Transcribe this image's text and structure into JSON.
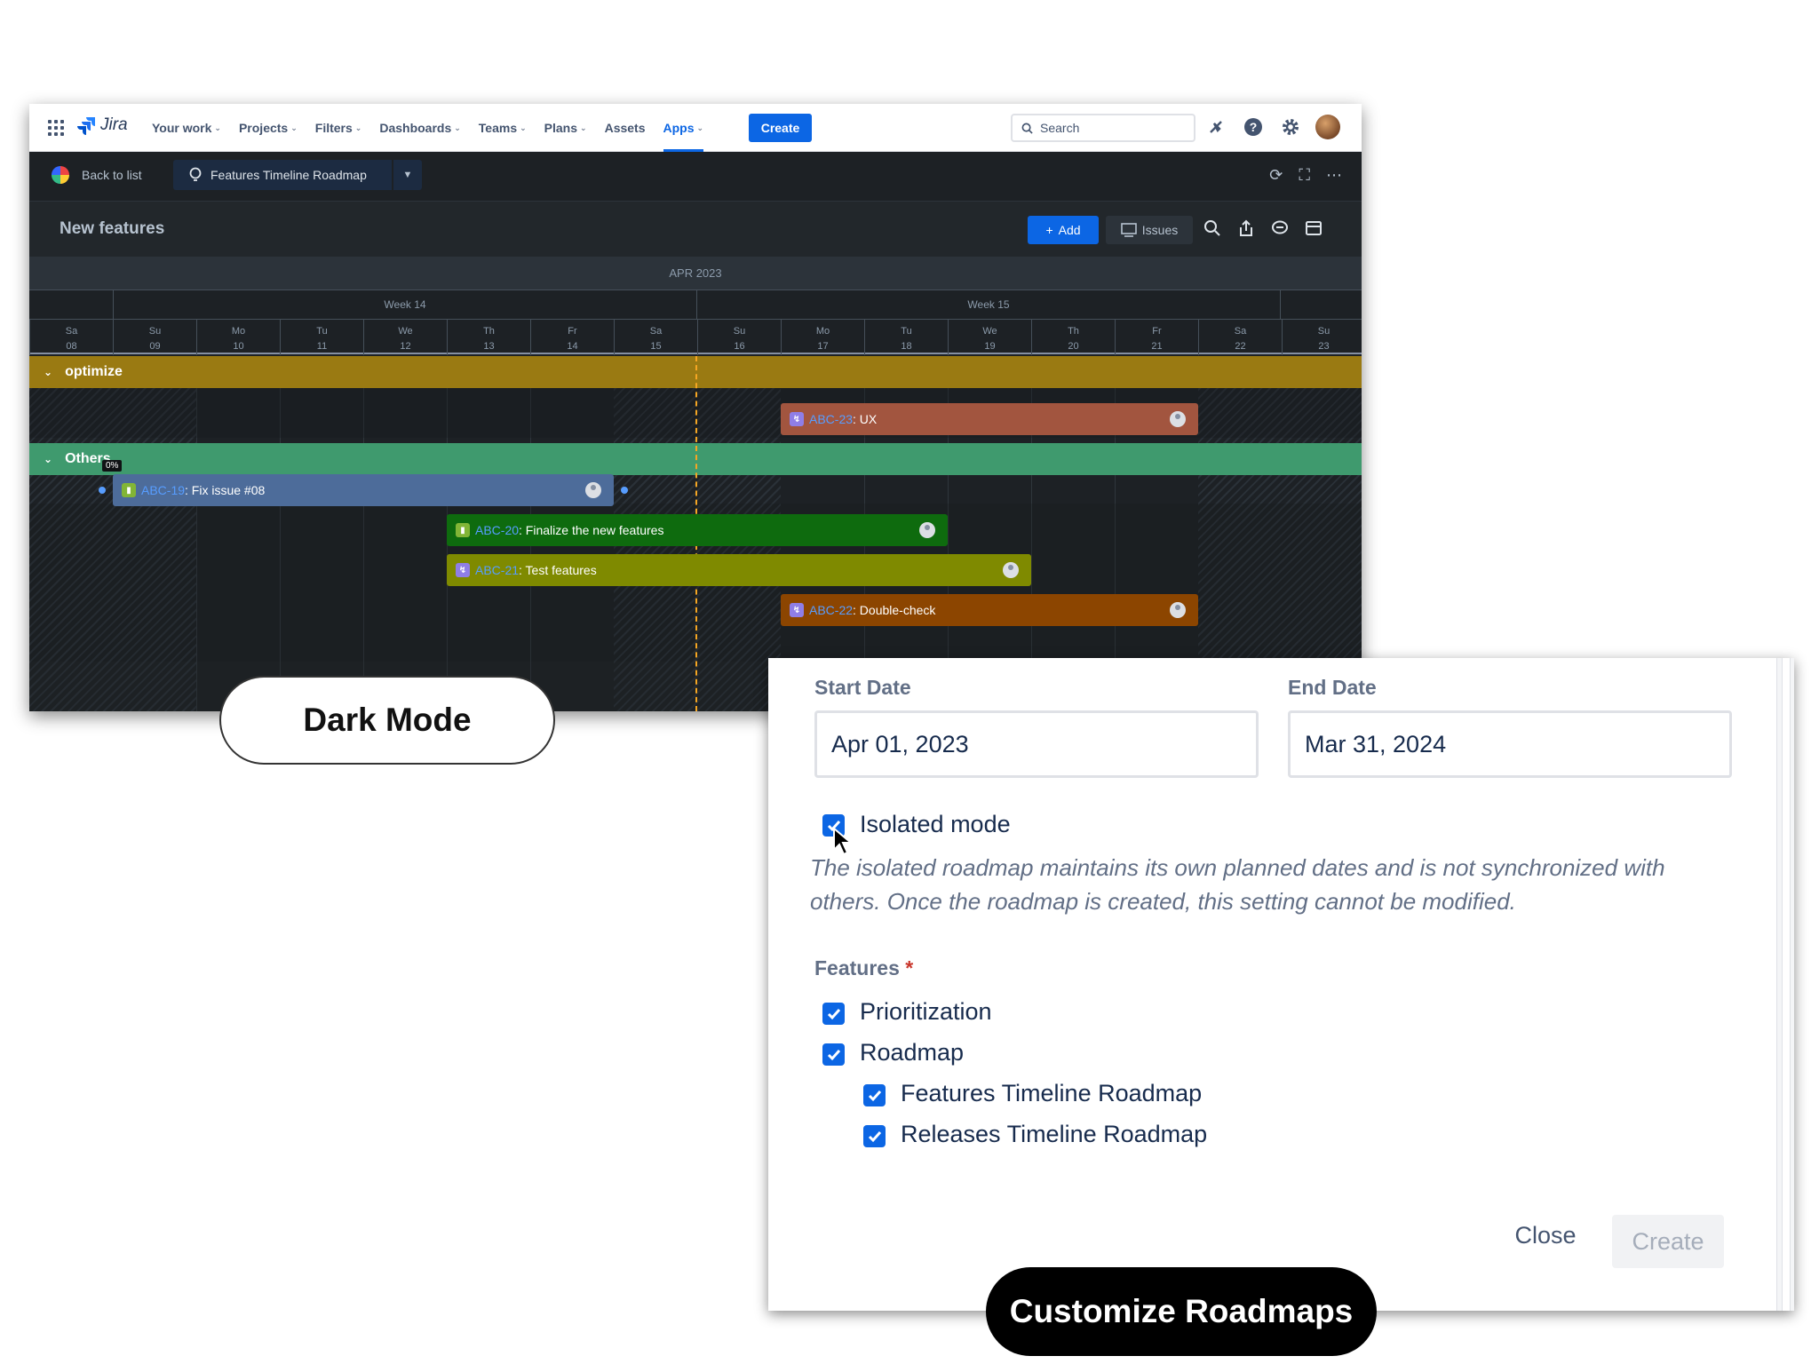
{
  "nav": {
    "logo": "Jira",
    "items": [
      "Your work",
      "Projects",
      "Filters",
      "Dashboards",
      "Teams",
      "Plans",
      "Assets",
      "Apps"
    ],
    "create": "Create",
    "search_placeholder": "Search"
  },
  "subbar": {
    "back": "Back to list",
    "roadmap": "Features Timeline Roadmap"
  },
  "titlebar": {
    "title": "New features",
    "add": "Add",
    "issues": "Issues"
  },
  "timeline": {
    "month": "APR 2023",
    "weeks": [
      "Week 14",
      "Week 15"
    ],
    "days": [
      {
        "d": "Sa",
        "n": "08"
      },
      {
        "d": "Su",
        "n": "09"
      },
      {
        "d": "Mo",
        "n": "10"
      },
      {
        "d": "Tu",
        "n": "11"
      },
      {
        "d": "We",
        "n": "12"
      },
      {
        "d": "Th",
        "n": "13"
      },
      {
        "d": "Fr",
        "n": "14"
      },
      {
        "d": "Sa",
        "n": "15"
      },
      {
        "d": "Su",
        "n": "16"
      },
      {
        "d": "Mo",
        "n": "17"
      },
      {
        "d": "Tu",
        "n": "18"
      },
      {
        "d": "We",
        "n": "19"
      },
      {
        "d": "Th",
        "n": "20"
      },
      {
        "d": "Fr",
        "n": "21"
      },
      {
        "d": "Sa",
        "n": "22"
      },
      {
        "d": "Su",
        "n": "23"
      }
    ],
    "groups": [
      {
        "name": "optimize",
        "color": "#9a7a12"
      },
      {
        "name": "Others",
        "color": "#3f9a6e"
      }
    ],
    "progress": "0%",
    "issues": [
      {
        "key": "ABC-23",
        "title": ": UX",
        "color": "#a2553f"
      },
      {
        "key": "ABC-19",
        "title": ": Fix issue #08",
        "color": "#4d6c9a"
      },
      {
        "key": "ABC-20",
        "title": ": Finalize the new features",
        "color": "#0e6b0e"
      },
      {
        "key": "ABC-21",
        "title": ": Test features",
        "color": "#7f8a00"
      },
      {
        "key": "ABC-22",
        "title": ": Double-check",
        "color": "#8c4500"
      }
    ]
  },
  "labels": {
    "dark_mode": "Dark Mode",
    "customize": "Customize Roadmaps"
  },
  "dialog": {
    "start_label": "Start Date",
    "start_value": "Apr 01, 2023",
    "end_label": "End Date",
    "end_value": "Mar 31, 2024",
    "isolated": "Isolated mode",
    "isolated_help": "The isolated roadmap maintains its own planned dates and is not synchronized with others. Once the roadmap is created, this setting cannot be modified.",
    "features_label": "Features",
    "required_mark": "*",
    "features": [
      "Prioritization",
      "Roadmap",
      "Features Timeline Roadmap",
      "Releases Timeline Roadmap"
    ],
    "close": "Close",
    "create": "Create"
  }
}
